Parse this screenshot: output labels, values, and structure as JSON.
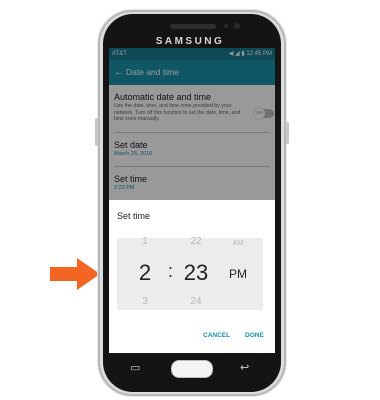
{
  "device": {
    "brand": "SAMSUNG"
  },
  "statusbar": {
    "carrier": "AT&T",
    "time": "12:45 PM"
  },
  "appbar": {
    "title": "Date and time"
  },
  "settings": {
    "auto": {
      "title": "Automatic date and time",
      "desc": "Use the date, time, and time zone provided by your network. Turn off this function to set the date, time, and time zone manually.",
      "toggle": "OFF"
    },
    "set_date": {
      "title": "Set date",
      "value": "March 25, 2016"
    },
    "set_time": {
      "title": "Set time",
      "value": "2:23 PM"
    }
  },
  "dialog": {
    "title": "Set time",
    "picker": {
      "hour_prev": "1",
      "hour": "2",
      "hour_next": "3",
      "minute_prev": "22",
      "minute": "23",
      "minute_next": "24",
      "ampm_prev": "AM",
      "ampm": "PM"
    },
    "cancel": "CANCEL",
    "done": "DONE"
  },
  "colors": {
    "accent": "#1a91a8",
    "statusbar": "#167a8f",
    "pointer": "#f26522"
  }
}
